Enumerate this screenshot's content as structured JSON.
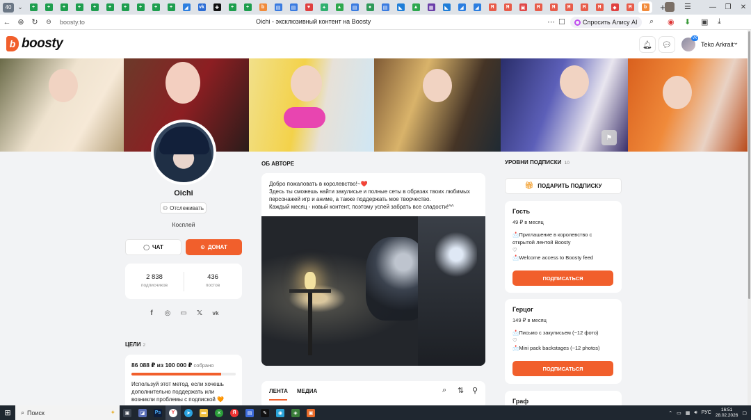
{
  "browser": {
    "tab_count": "40",
    "active_url": "boosty.to",
    "page_title": "Oichi - эксклюзивный контент на Boosty",
    "alice_label": "Спросить Алису AI",
    "tabs": [
      {
        "color": "#1e9e4e",
        "glyph": "+"
      },
      {
        "color": "#1e9e4e",
        "glyph": "+"
      },
      {
        "color": "#1e9e4e",
        "glyph": "+"
      },
      {
        "color": "#1e9e4e",
        "glyph": "+"
      },
      {
        "color": "#1e9e4e",
        "glyph": "+"
      },
      {
        "color": "#1e9e4e",
        "glyph": "+"
      },
      {
        "color": "#1e9e4e",
        "glyph": "+"
      },
      {
        "color": "#1e9e4e",
        "glyph": "+"
      },
      {
        "color": "#1e9e4e",
        "glyph": "+"
      },
      {
        "color": "#1e9e4e",
        "glyph": "+"
      },
      {
        "color": "#2d7fe0",
        "glyph": "◢"
      },
      {
        "color": "#2b6cd4",
        "glyph": "vk"
      },
      {
        "color": "#111111",
        "glyph": "✚"
      },
      {
        "color": "#1e9e4e",
        "glyph": "+"
      },
      {
        "color": "#1e9e4e",
        "glyph": "+"
      },
      {
        "color": "#f18b3b",
        "glyph": "b"
      },
      {
        "color": "#3a7be0",
        "glyph": "▤"
      },
      {
        "color": "#3a7be0",
        "glyph": "▤"
      },
      {
        "color": "#e04040",
        "glyph": "♥"
      },
      {
        "color": "#30b070",
        "glyph": "✦"
      },
      {
        "color": "#2da84d",
        "glyph": "▲"
      },
      {
        "color": "#3a7be0",
        "glyph": "▤"
      },
      {
        "color": "#2f9a5a",
        "glyph": "●"
      },
      {
        "color": "#3a7be0",
        "glyph": "▤"
      },
      {
        "color": "#1f7ed8",
        "glyph": "◣"
      },
      {
        "color": "#2da84d",
        "glyph": "▲"
      },
      {
        "color": "#6a3ea8",
        "glyph": "▦"
      },
      {
        "color": "#1f7ed8",
        "glyph": "◣"
      },
      {
        "color": "#2d7fe0",
        "glyph": "◢"
      },
      {
        "color": "#2d7fe0",
        "glyph": "◢"
      },
      {
        "color": "#e85c4a",
        "glyph": "Я"
      },
      {
        "color": "#e85c4a",
        "glyph": "Я"
      },
      {
        "color": "#e04848",
        "glyph": "▣"
      },
      {
        "color": "#e85c4a",
        "glyph": "Я"
      },
      {
        "color": "#e85c4a",
        "glyph": "Я"
      },
      {
        "color": "#e85c4a",
        "glyph": "Я"
      },
      {
        "color": "#e85c4a",
        "glyph": "Я"
      },
      {
        "color": "#e85c4a",
        "glyph": "Я"
      },
      {
        "color": "#e04040",
        "glyph": "◆"
      },
      {
        "color": "#e85c4a",
        "glyph": "Я"
      }
    ],
    "active_tab": {
      "color": "#f18b3b",
      "glyph": "b"
    }
  },
  "header": {
    "logo_text": "boosty",
    "username": "Teko Arkrait",
    "badge": "VK"
  },
  "author": {
    "name": "Oichi",
    "follow_label": "Отслеживать",
    "category": "Косплей",
    "chat_label": "ЧАТ",
    "donate_label": "ДОНАТ",
    "subscribers_count": "2 838",
    "subscribers_label": "подписчиков",
    "posts_count": "436",
    "posts_label": "постов"
  },
  "goals": {
    "title": "ЦЕЛИ",
    "count": "2",
    "amount": "86 088 ₽ из 100 000 ₽",
    "amount_suffix": "собрано",
    "progress": 0.86,
    "description": "Используй этот метод, если хочешь дополнительно поддержать или возникли проблемы с подпиской 🧡"
  },
  "about": {
    "title": "ОБ АВТОРЕ",
    "text": "Добро пожаловать в королевство!~❤️\nЗдесь ты сможешь найти закулисье и полные сеты в образах твоих любимых персонажей игр и аниме, а также поддержать мое творчество.\nКаждый месяц - новый контент, поэтому успей забрать все сладости!^^"
  },
  "feed": {
    "tab_feed": "ЛЕНТА",
    "tab_media": "МЕДИА"
  },
  "tiers": {
    "title": "УРОВНИ ПОДПИСКИ",
    "count": "10",
    "gift_label": "ПОДАРИТЬ ПОДПИСКУ",
    "subscribe_label": "ПОДПИСАТЬСЯ",
    "items": [
      {
        "name": "Гость",
        "price": "49 ₽ в месяц",
        "desc": "📩Приглашение в королевство с открытой лентой Boosty\n♡\n📩Welcome access to Boosty feed"
      },
      {
        "name": "Герцог",
        "price": "149 ₽ в месяц",
        "desc": "📩Письмо с закулисьем (~12 фото)\n♡\n📩Mini pack backstages (~12 photos)"
      },
      {
        "name": "Граф",
        "price": "",
        "desc": ""
      }
    ]
  },
  "taskbar": {
    "search_label": "Поиск",
    "lang": "РУС",
    "time": "16:51",
    "date": "28.02.2026"
  },
  "colors": {
    "accent": "#f15f2c"
  }
}
